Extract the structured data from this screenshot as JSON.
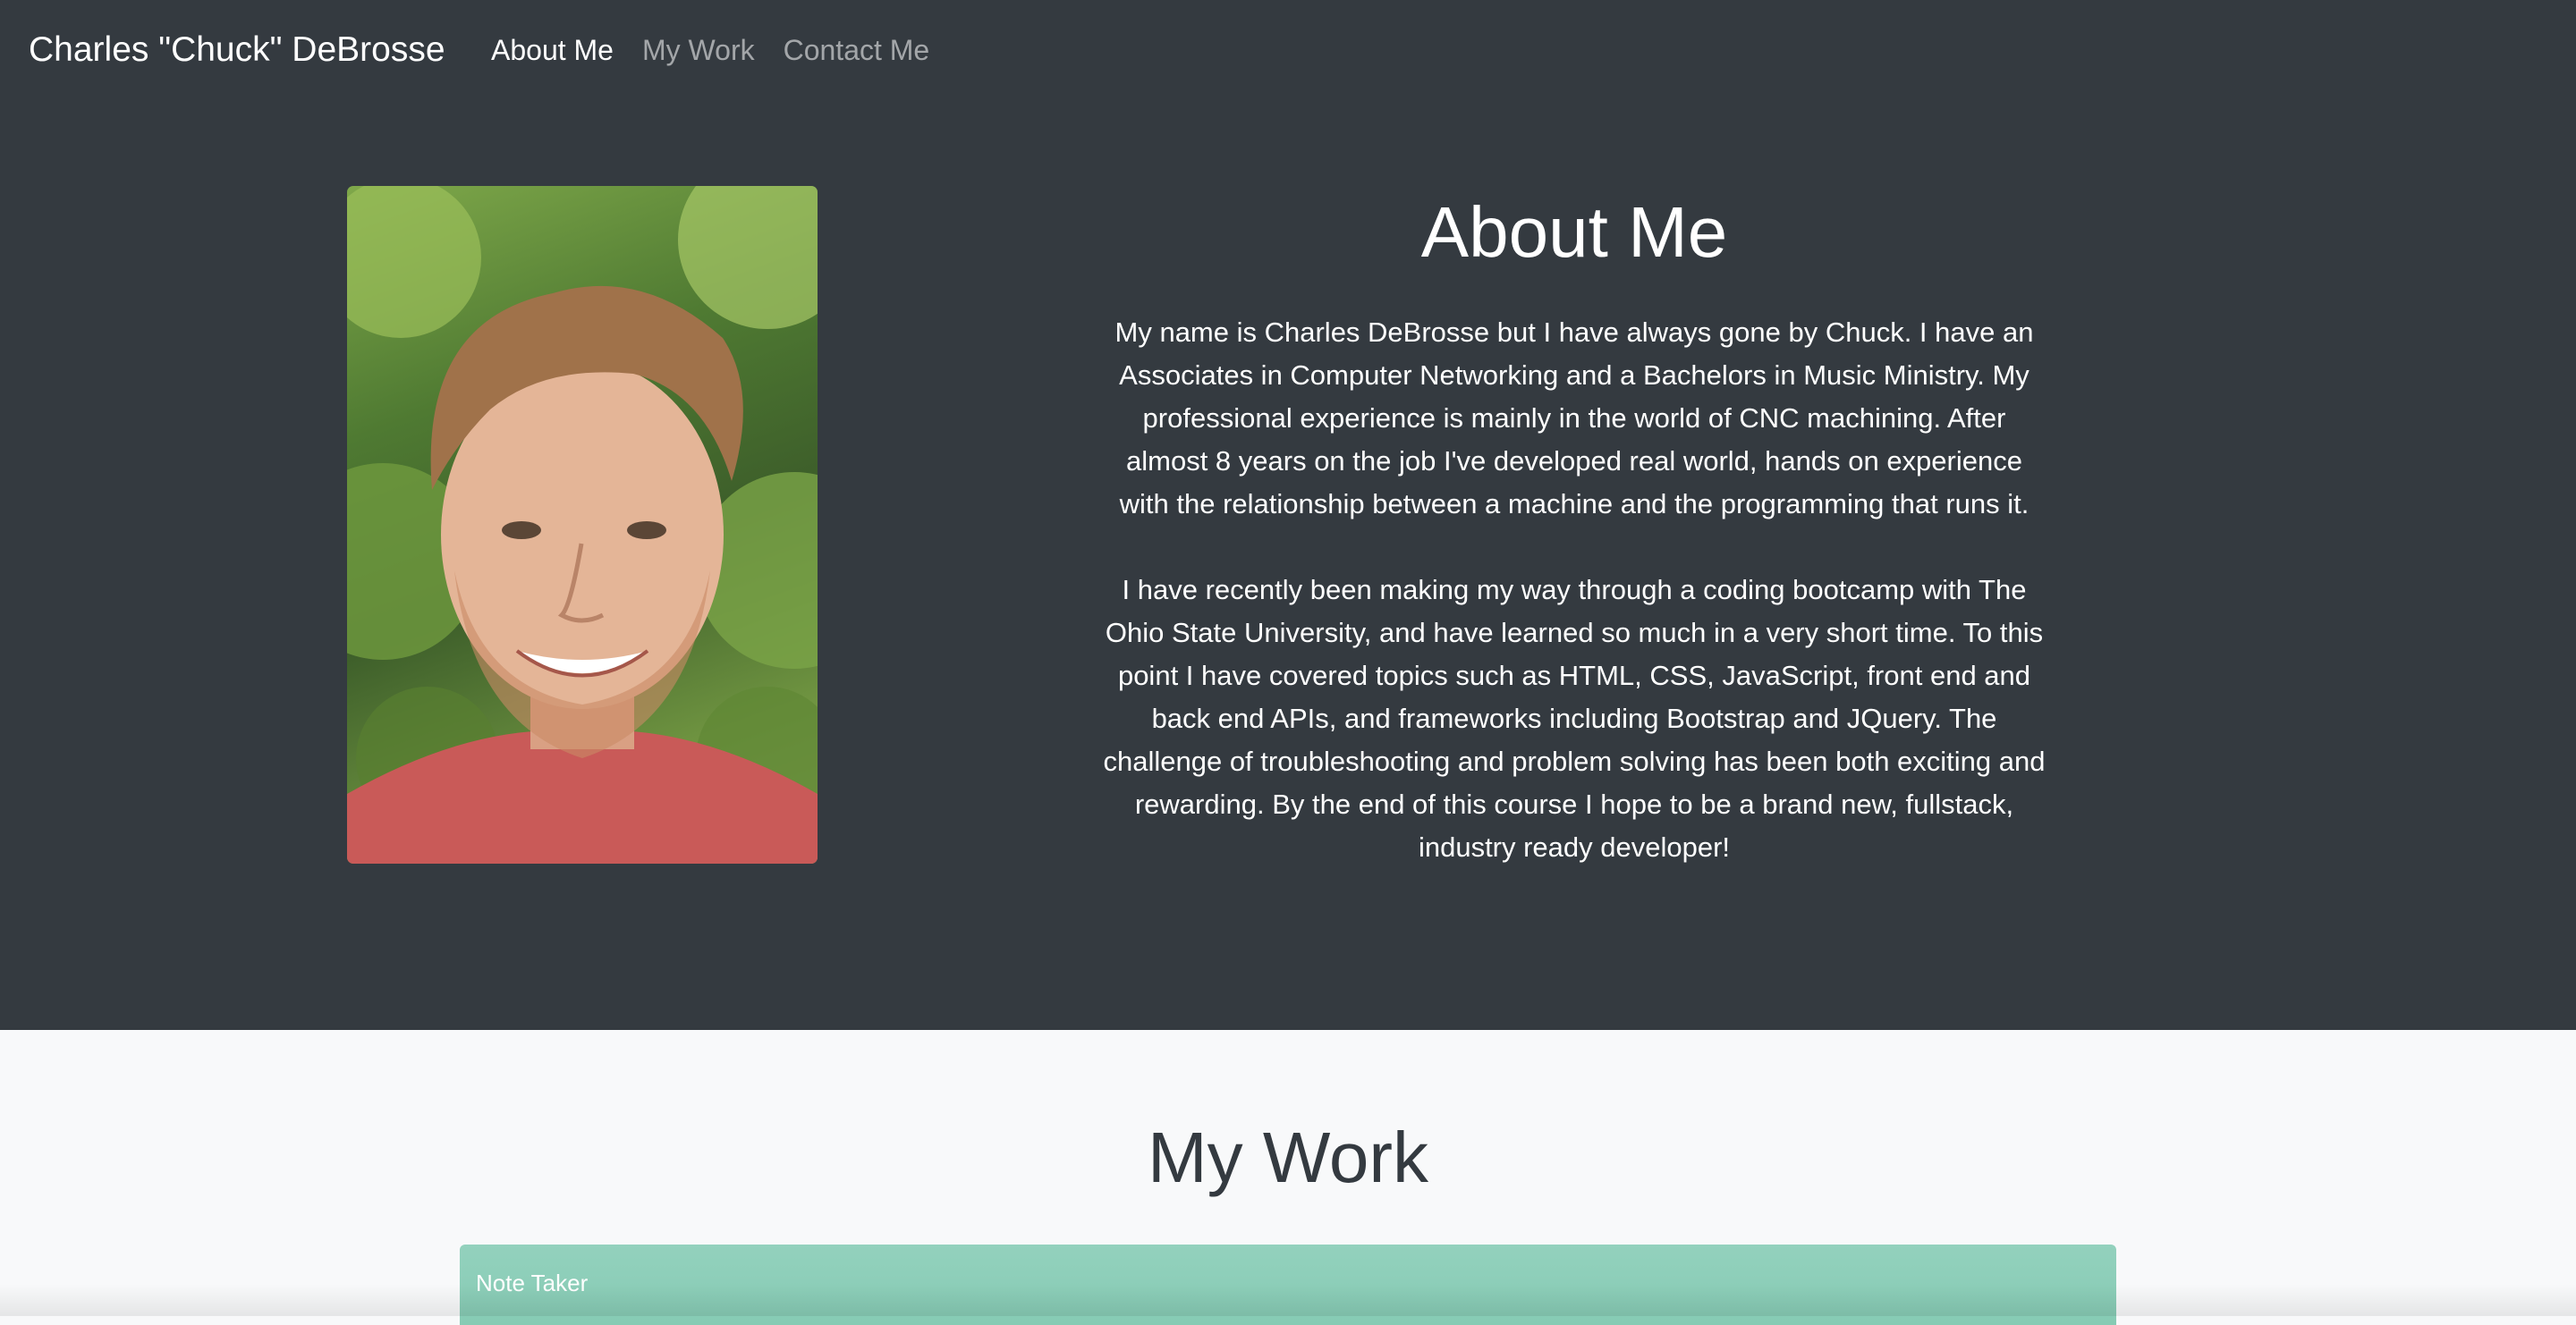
{
  "navbar": {
    "brand": "Charles \"Chuck\" DeBrosse",
    "links": [
      {
        "label": "About Me",
        "active": true
      },
      {
        "label": "My Work",
        "active": false
      },
      {
        "label": "Contact Me",
        "active": false
      }
    ]
  },
  "about": {
    "heading": "About Me",
    "paragraph_1": "My name is Charles DeBrosse but I have always gone by Chuck. I have an Associates in Computer Networking and a Bachelors in Music Ministry. My professional experience is mainly in the world of CNC machining. After almost 8 years on the job I've developed real world, hands on experience with the relationship between a machine and the programming that runs it.",
    "paragraph_2": "I have recently been making my way through a coding bootcamp with The Ohio State University, and have learned so much in a very short time. To this point I have covered topics such as HTML, CSS, JavaScript, front end and back end APIs, and frameworks including Bootstrap and JQuery. The challenge of troubleshooting and problem solving has been both exciting and rewarding. By the end of this course I hope to be a brand new, fullstack, industry ready developer!"
  },
  "work": {
    "heading": "My Work",
    "cards": [
      {
        "title": "Note Taker"
      }
    ]
  },
  "colors": {
    "dark_bg": "#343a40",
    "light_bg": "#f8f9fa",
    "card_accent": "#8ecfb9"
  }
}
